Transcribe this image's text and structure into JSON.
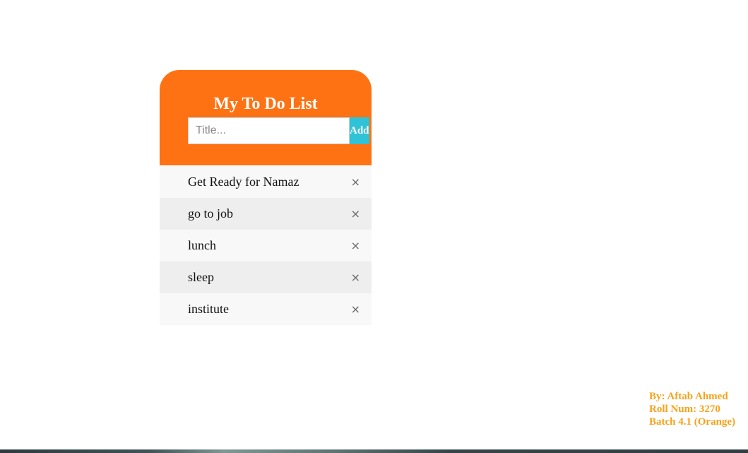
{
  "header": {
    "title": "My To Do List",
    "input_placeholder": "Title...",
    "input_value": "",
    "add_label": "Add"
  },
  "todos": [
    {
      "label": "Get Ready for Namaz",
      "close": "×"
    },
    {
      "label": "go to job",
      "close": "×"
    },
    {
      "label": "lunch",
      "close": "×"
    },
    {
      "label": "sleep",
      "close": "×"
    },
    {
      "label": "institute",
      "close": "×"
    }
  ],
  "credits": {
    "line1": "By: Aftab Ahmed",
    "line2": "Roll Num: 3270",
    "line3": "Batch 4.1 (Orange)"
  },
  "colors": {
    "header_bg": "#ff7213",
    "add_button_bg": "#30c2d6",
    "credits_text": "#f7a21b",
    "item_odd_bg": "#f8f8f8",
    "item_even_bg": "#eeeeee"
  }
}
